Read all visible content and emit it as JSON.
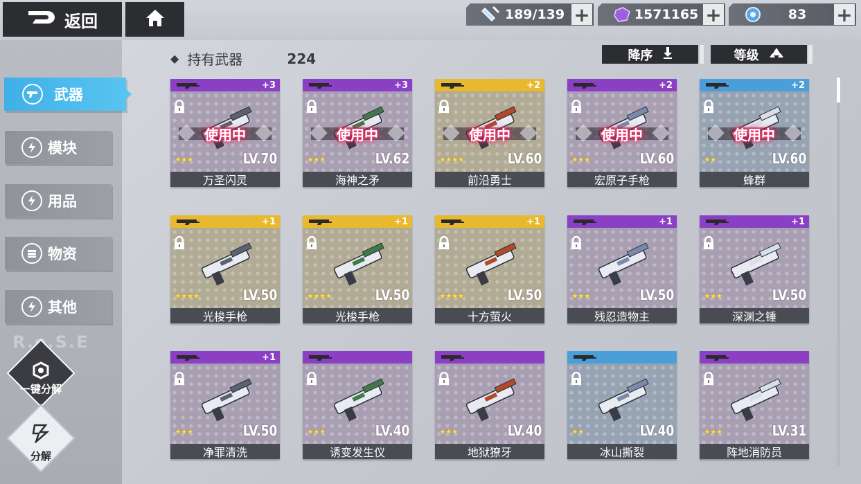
{
  "topbar": {
    "back_label": "返回",
    "currencies": [
      {
        "icon": "stamina-bottle-icon",
        "value": "189/139"
      },
      {
        "icon": "purple-crystal-icon",
        "value": "1571165"
      },
      {
        "icon": "blue-orb-icon",
        "value": "83"
      }
    ]
  },
  "sidebar": {
    "items": [
      {
        "label": "武器",
        "icon": "gun-icon",
        "active": true
      },
      {
        "label": "模块",
        "icon": "lightning-icon",
        "active": false
      },
      {
        "label": "用品",
        "icon": "lightning-icon",
        "active": false
      },
      {
        "label": "物资",
        "icon": "stack-icon",
        "active": false
      },
      {
        "label": "其他",
        "icon": "lightning-icon",
        "active": false
      }
    ],
    "watermark": "R.o.S.E",
    "one_click_dismantle_label": "一键分解",
    "dismantle_label": "分解"
  },
  "header": {
    "title": "持有武器",
    "count": "224",
    "sort_label": "降序",
    "filter_label": "等级"
  },
  "colors": {
    "purple": "#8a3fc4",
    "gold": "#e8b92e",
    "blue": "#4a9fd8",
    "active_tab": "#3fb0e8"
  },
  "weapons": [
    {
      "name": "万圣闪灵",
      "level": "LV.70",
      "plus": "+3",
      "stars": 3,
      "rarity": "purple",
      "in_use": true,
      "in_use_label": "使用中"
    },
    {
      "name": "海神之矛",
      "level": "LV.62",
      "plus": "+3",
      "stars": 3,
      "rarity": "purple",
      "in_use": true,
      "in_use_label": "使用中"
    },
    {
      "name": "前沿勇士",
      "level": "LV.60",
      "plus": "+2",
      "stars": 4,
      "rarity": "gold",
      "in_use": true,
      "in_use_label": "使用中"
    },
    {
      "name": "宏原子手枪",
      "level": "LV.60",
      "plus": "+2",
      "stars": 3,
      "rarity": "purple",
      "in_use": true,
      "in_use_label": "使用中"
    },
    {
      "name": "蜂群",
      "level": "LV.60",
      "plus": "+2",
      "stars": 2,
      "rarity": "blue",
      "in_use": true,
      "in_use_label": "使用中"
    },
    {
      "name": "光梭手枪",
      "level": "LV.50",
      "plus": "+1",
      "stars": 4,
      "rarity": "gold",
      "in_use": false
    },
    {
      "name": "光梭手枪",
      "level": "LV.50",
      "plus": "+1",
      "stars": 4,
      "rarity": "gold",
      "in_use": false
    },
    {
      "name": "十方萤火",
      "level": "LV.50",
      "plus": "+1",
      "stars": 4,
      "rarity": "gold",
      "in_use": false
    },
    {
      "name": "残忍造物主",
      "level": "LV.50",
      "plus": "+1",
      "stars": 3,
      "rarity": "purple",
      "in_use": false
    },
    {
      "name": "深渊之锤",
      "level": "LV.50",
      "plus": "+1",
      "stars": 3,
      "rarity": "purple",
      "in_use": false
    },
    {
      "name": "净罪清洗",
      "level": "LV.50",
      "plus": "+1",
      "stars": 3,
      "rarity": "purple",
      "in_use": false
    },
    {
      "name": "诱变发生仪",
      "level": "LV.40",
      "plus": "",
      "stars": 3,
      "rarity": "purple",
      "in_use": false
    },
    {
      "name": "地狱獠牙",
      "level": "LV.40",
      "plus": "",
      "stars": 3,
      "rarity": "purple",
      "in_use": false
    },
    {
      "name": "冰山撕裂",
      "level": "LV.40",
      "plus": "",
      "stars": 2,
      "rarity": "blue",
      "in_use": false
    },
    {
      "name": "阵地消防员",
      "level": "LV.31",
      "plus": "",
      "stars": 3,
      "rarity": "purple",
      "in_use": false
    }
  ]
}
